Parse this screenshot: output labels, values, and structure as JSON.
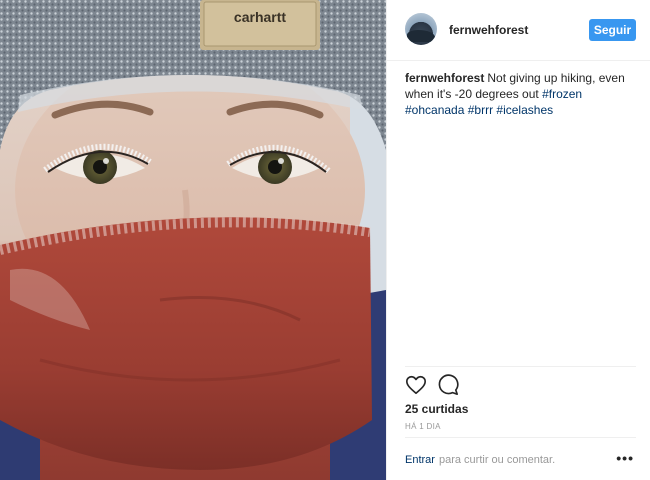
{
  "photo": {
    "beanie_label": "carhartt"
  },
  "header": {
    "username": "fernwehforest",
    "follow_label": "Seguir"
  },
  "caption": {
    "author": "fernwehforest",
    "text": "Not giving up hiking, even when it's -20 degrees out",
    "hashtags": [
      "#frozen",
      "#ohcanada",
      "#brrr",
      "#icelashes"
    ]
  },
  "actions": {
    "like_icon": "heart-icon",
    "comment_icon": "comment-icon",
    "likes_count": "25 curtidas",
    "timestamp": "HÁ 1 DIA"
  },
  "footer": {
    "login_label": "Entrar",
    "prompt": "para curtir ou comentar.",
    "more_label": "•••"
  },
  "colors": {
    "accent": "#3897f0",
    "hashtag": "#003569",
    "muted": "#999999",
    "scarf": "#a9463a",
    "beanie": "#7d8690"
  }
}
